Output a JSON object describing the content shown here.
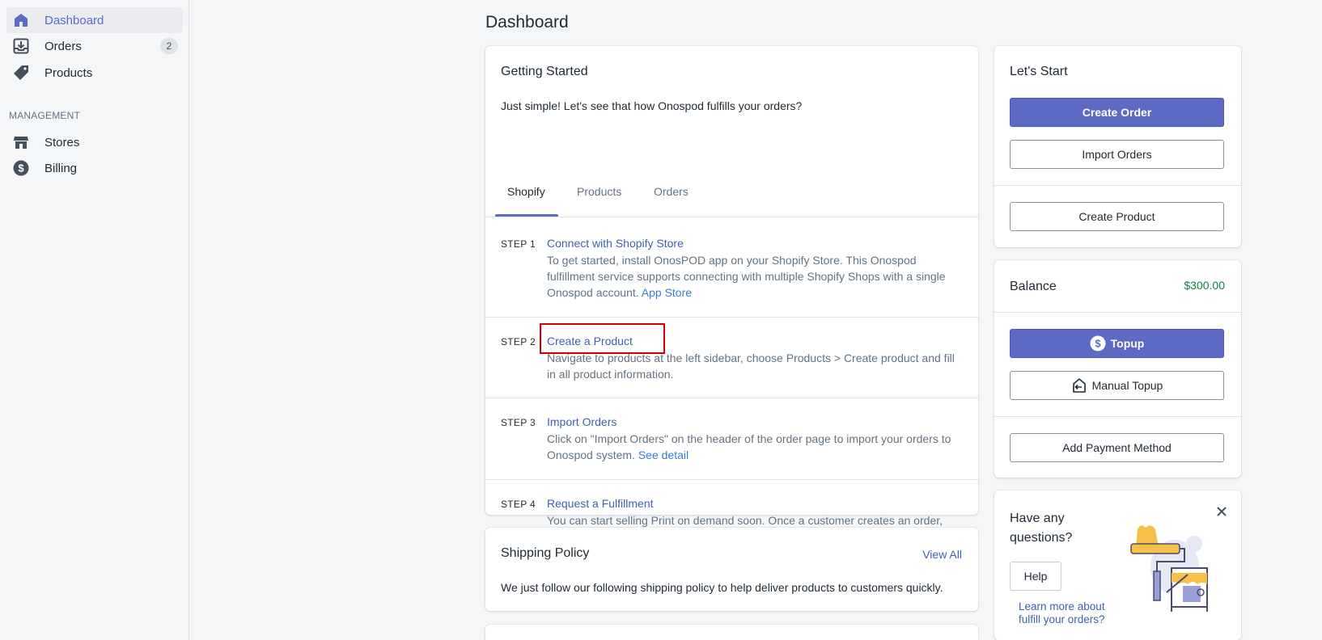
{
  "sidebar": {
    "items": [
      {
        "label": "Dashboard",
        "icon": "home-icon"
      },
      {
        "label": "Orders",
        "icon": "inbox-download-icon",
        "badge": "2"
      },
      {
        "label": "Products",
        "icon": "tag-icon"
      }
    ],
    "management_title": "MANAGEMENT",
    "management_items": [
      {
        "label": "Stores",
        "icon": "store-icon"
      },
      {
        "label": "Billing",
        "icon": "dollar-circle-icon"
      }
    ]
  },
  "page": {
    "title": "Dashboard"
  },
  "getting_started": {
    "title": "Getting Started",
    "intro": "Just simple! Let's see that how Onospod fulfills your orders?",
    "tabs": [
      "Shopify",
      "Products",
      "Orders"
    ],
    "steps": [
      {
        "num": "STEP 1",
        "title": "Connect with Shopify Store",
        "desc": "To get started, install OnosPOD app on your Shopify Store. This Onospod fulfillment service supports connecting with multiple Shopify Shops with a single Onospod account.",
        "link": "App Store"
      },
      {
        "num": "STEP 2",
        "title": "Create a Product",
        "desc": "Navigate to products at the left sidebar, choose Products > Create product and fill in all product information."
      },
      {
        "num": "STEP 3",
        "title": "Import Orders",
        "desc": "Click on \"Import Orders\" on the header of the order page to import your orders to Onospod system.",
        "link": "See detail"
      },
      {
        "num": "STEP 4",
        "title": "Request a Fulfillment",
        "desc": "You can start selling Print on demand soon. Once a customer creates an order, you can request fulfillment for the order directly through the Shopify store."
      }
    ]
  },
  "shipping": {
    "title": "Shipping Policy",
    "view_all": "View All",
    "text": "We just follow our following shipping policy to help deliver products to customers quickly."
  },
  "lets_start": {
    "title": "Let's Start",
    "create_order": "Create Order",
    "import_orders": "Import Orders",
    "create_product": "Create Product"
  },
  "balance": {
    "title": "Balance",
    "amount": "$300.00",
    "topup": "Topup",
    "manual_topup": "Manual Topup",
    "add_payment": "Add Payment Method"
  },
  "help_card": {
    "title_line1": "Have any",
    "title_line2": "questions?",
    "help_button": "Help",
    "learn_line1": "Learn more about",
    "learn_line2": "fulfill your orders?"
  },
  "colors": {
    "accent": "#5c6ac4",
    "link": "#3f5fae",
    "balance": "#108043",
    "highlight": "#d40000"
  }
}
